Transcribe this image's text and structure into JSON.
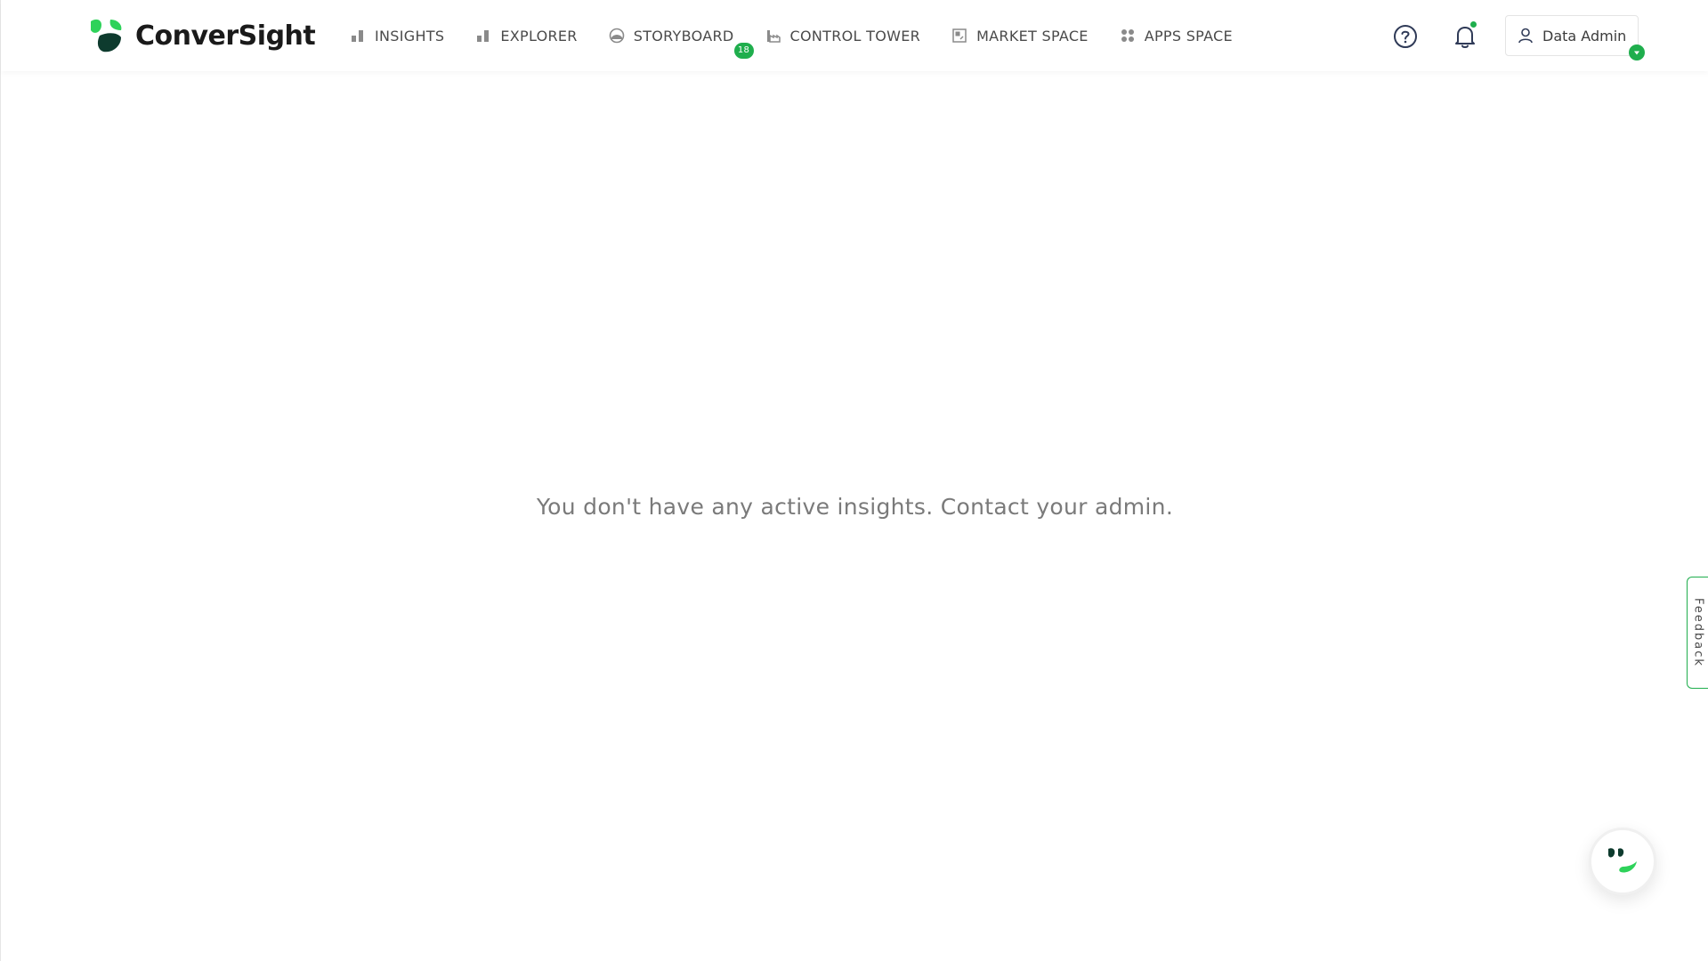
{
  "app": {
    "brand_name": "ConverSight",
    "brand_colors": {
      "dark": "#0e3b2e",
      "green": "#1fae4d",
      "light_green": "#2ed25a"
    }
  },
  "nav": {
    "items": [
      {
        "label": "INSIGHTS",
        "icon": "bar-chart-icon"
      },
      {
        "label": "EXPLORER",
        "icon": "bar-chart-icon"
      },
      {
        "label": "STORYBOARD",
        "icon": "palette-icon",
        "badge": "18"
      },
      {
        "label": "CONTROL TOWER",
        "icon": "factory-icon"
      },
      {
        "label": "MARKET SPACE",
        "icon": "store-icon"
      },
      {
        "label": "APPS SPACE",
        "icon": "grid-icon"
      }
    ]
  },
  "header": {
    "help_icon": "help-circle-icon",
    "notification_icon": "bell-icon",
    "user_name": "Data Admin",
    "user_icon": "user-icon"
  },
  "main": {
    "empty_message": "You don't have any active insights. Contact your admin."
  },
  "feedback": {
    "label": "Feedback"
  },
  "chat": {
    "icon": "conversight-chat-icon"
  }
}
